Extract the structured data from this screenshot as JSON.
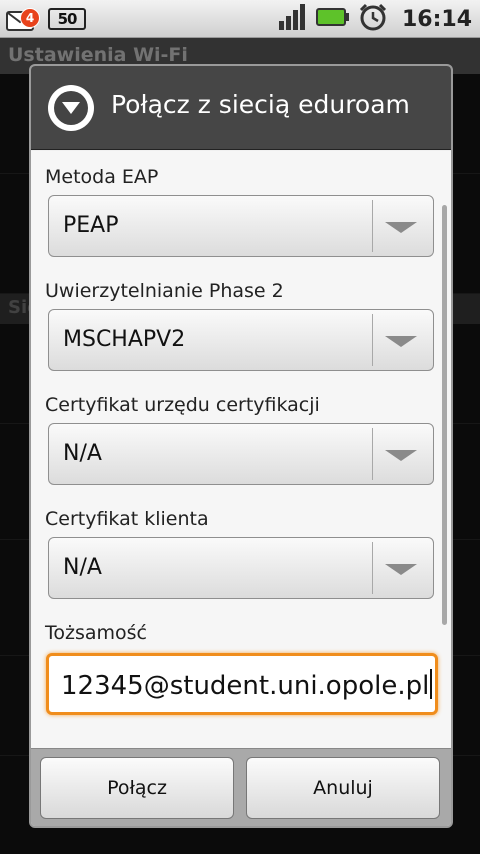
{
  "status_bar": {
    "notification_count": "4",
    "battery_alt": "50",
    "time": "16:14",
    "icons": [
      "gmail-icon",
      "signal-icon",
      "battery-icon",
      "alarm-icon"
    ]
  },
  "background": {
    "title": "Ustawienia Wi-Fi",
    "section": "Sie"
  },
  "dialog": {
    "title": "Połącz z siecią eduroam",
    "fields": [
      {
        "label": "Metoda EAP",
        "value": "PEAP"
      },
      {
        "label": "Uwierzytelnianie Phase 2",
        "value": "MSCHAPV2"
      },
      {
        "label": "Certyfikat urzędu certyfikacji",
        "value": "N/A"
      },
      {
        "label": "Certyfikat klienta",
        "value": "N/A"
      }
    ],
    "identity": {
      "label": "Tożsamość",
      "value": "12345@student.uni.opole.pl"
    },
    "buttons": {
      "connect": "Połącz",
      "cancel": "Anuluj"
    }
  },
  "colors": {
    "focus_accent": "#f08d1c",
    "header_bg": "#464646",
    "notification_badge": "#e8431c"
  }
}
